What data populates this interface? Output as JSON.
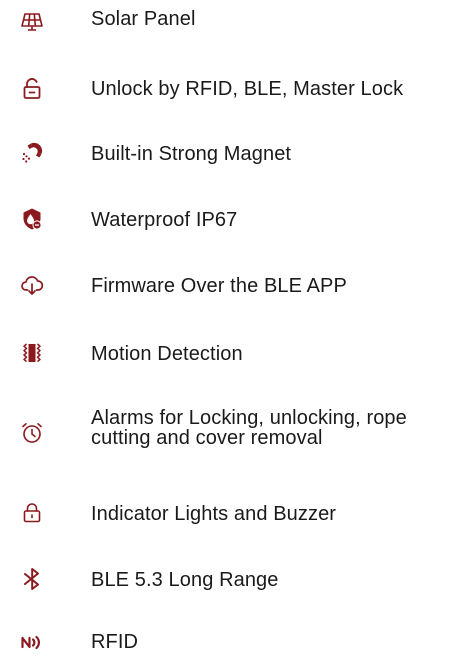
{
  "accent_color": "#8b1a1f",
  "features": [
    {
      "icon": "solar-panel-icon",
      "label": "Solar Panel"
    },
    {
      "icon": "unlock-icon",
      "label": "Unlock by RFID, BLE, Master Lock"
    },
    {
      "icon": "magnet-icon",
      "label": "Built-in Strong Magnet"
    },
    {
      "icon": "waterproof-icon",
      "label": "Waterproof IP67"
    },
    {
      "icon": "cloud-download-icon",
      "label": "Firmware Over the BLE APP"
    },
    {
      "icon": "motion-detection-icon",
      "label": "Motion Detection"
    },
    {
      "icon": "alarm-clock-icon",
      "label": "Alarms for Locking, unlocking, rope cutting and cover removal"
    },
    {
      "icon": "padlock-icon",
      "label": "Indicator Lights and Buzzer"
    },
    {
      "icon": "bluetooth-icon",
      "label": "BLE 5.3 Long Range"
    },
    {
      "icon": "rfid-icon",
      "label": "RFID"
    }
  ]
}
